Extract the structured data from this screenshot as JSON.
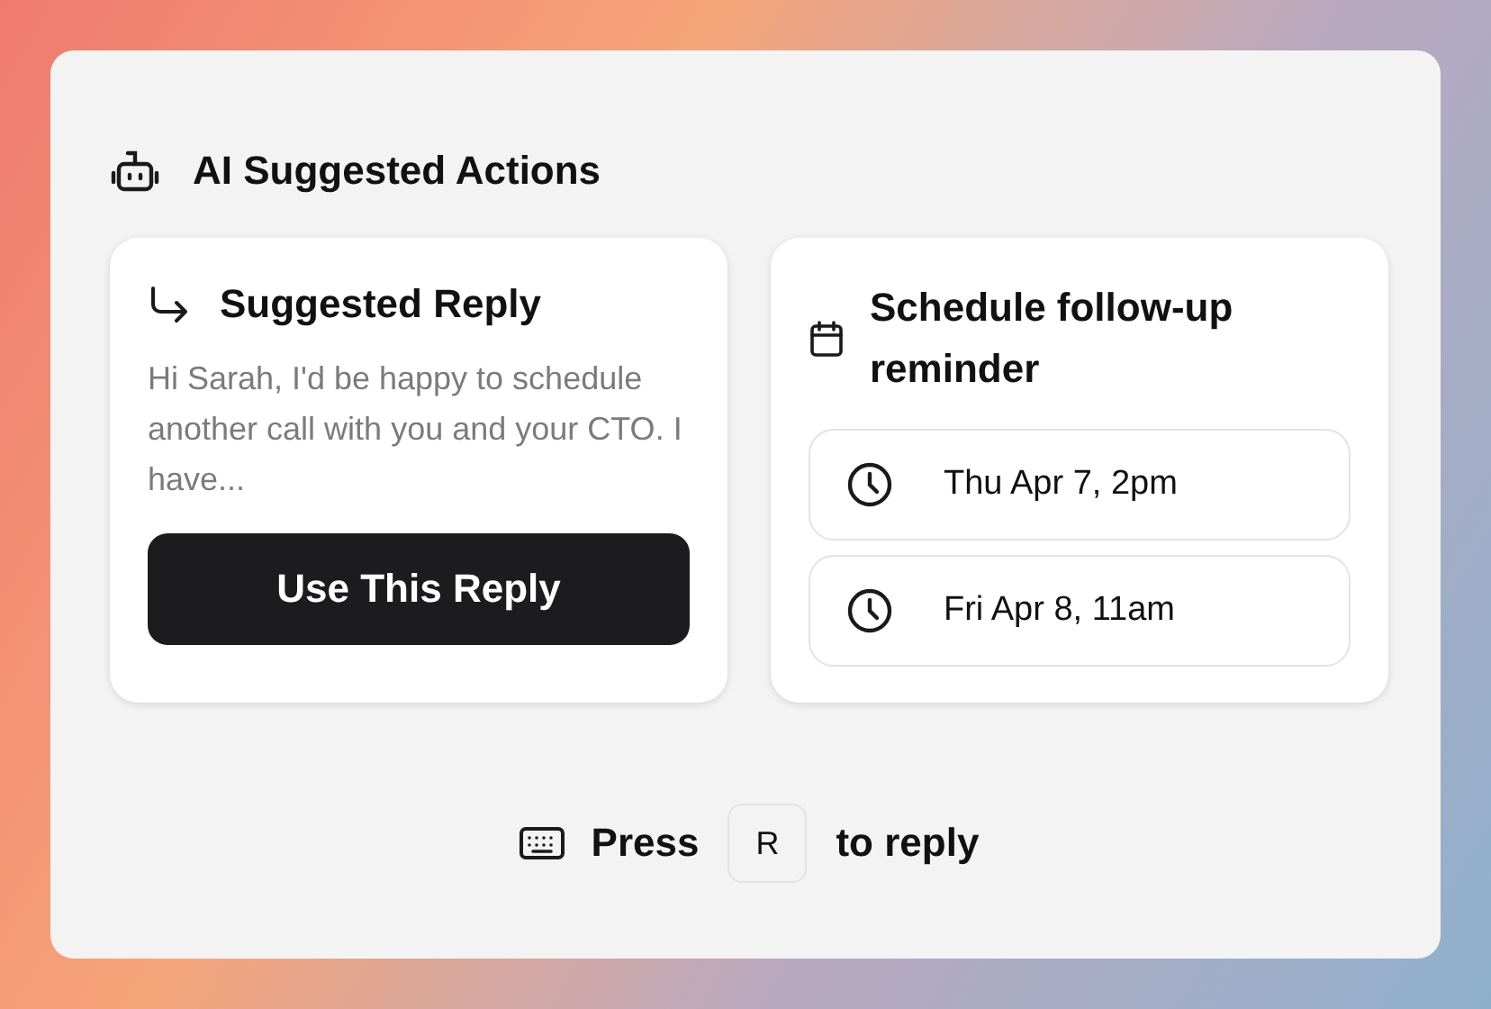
{
  "header": {
    "title": "AI Suggested Actions"
  },
  "reply_card": {
    "title": "Suggested Reply",
    "preview": "Hi Sarah, I'd be happy to schedule another call with you and your CTO. I have...",
    "button": "Use This Reply"
  },
  "schedule_card": {
    "title": "Schedule follow-up reminder",
    "slots": [
      {
        "label": "Thu Apr 7, 2pm"
      },
      {
        "label": "Fri Apr 8, 11am"
      }
    ]
  },
  "hint": {
    "before": "Press",
    "key": "R",
    "after": "to reply"
  }
}
